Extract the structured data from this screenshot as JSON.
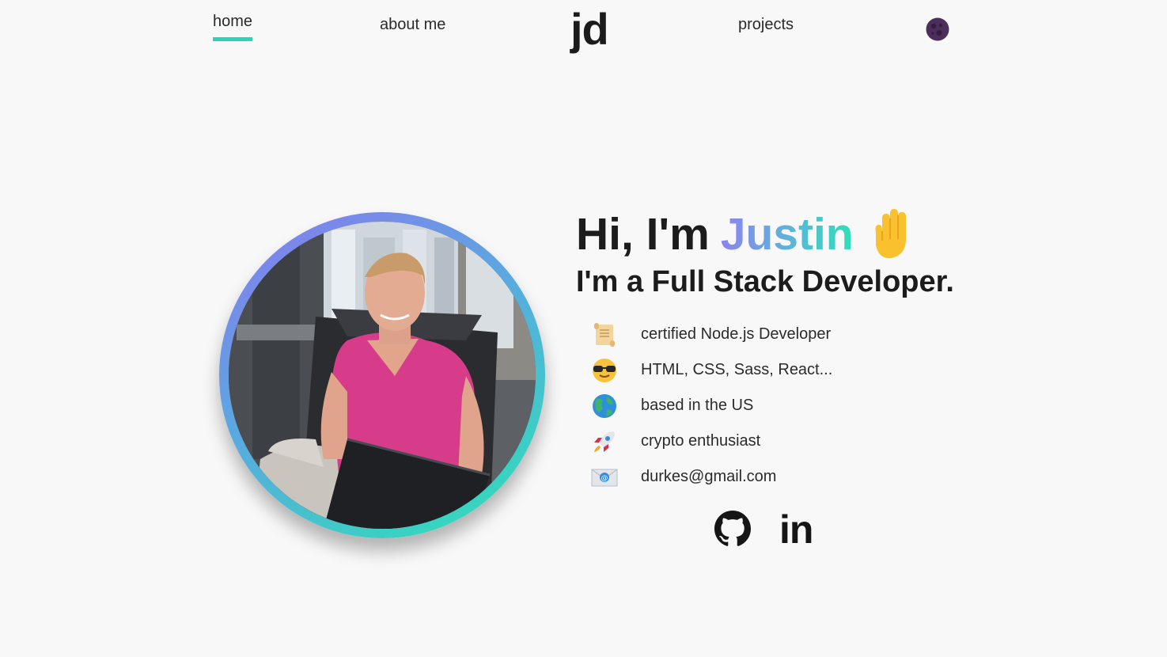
{
  "nav": {
    "home_label": "home",
    "about_label": "about me",
    "logo_text": "jd",
    "projects_label": "projects",
    "theme_toggle_icon": "moon-icon",
    "accent_color": "#2bd4b7"
  },
  "hero": {
    "greeting_prefix": "Hi, I'm",
    "name": "Justin",
    "wave_icon": "waving-hand-icon",
    "tagline": "I'm a Full Stack Developer.",
    "facts": [
      {
        "icon": "scroll-icon",
        "text": "certified Node.js Developer"
      },
      {
        "icon": "sunglasses-face-icon",
        "text": "HTML, CSS, Sass, React..."
      },
      {
        "icon": "globe-icon",
        "text": "based in the US"
      },
      {
        "icon": "rocket-icon",
        "text": "crypto enthusiast"
      },
      {
        "icon": "envelope-icon",
        "text": "durkes@gmail.com"
      }
    ],
    "social": {
      "github_icon": "github-icon",
      "linkedin_text": "in"
    },
    "gradient_colors": [
      "#8a78ee",
      "#2be3b5"
    ]
  }
}
